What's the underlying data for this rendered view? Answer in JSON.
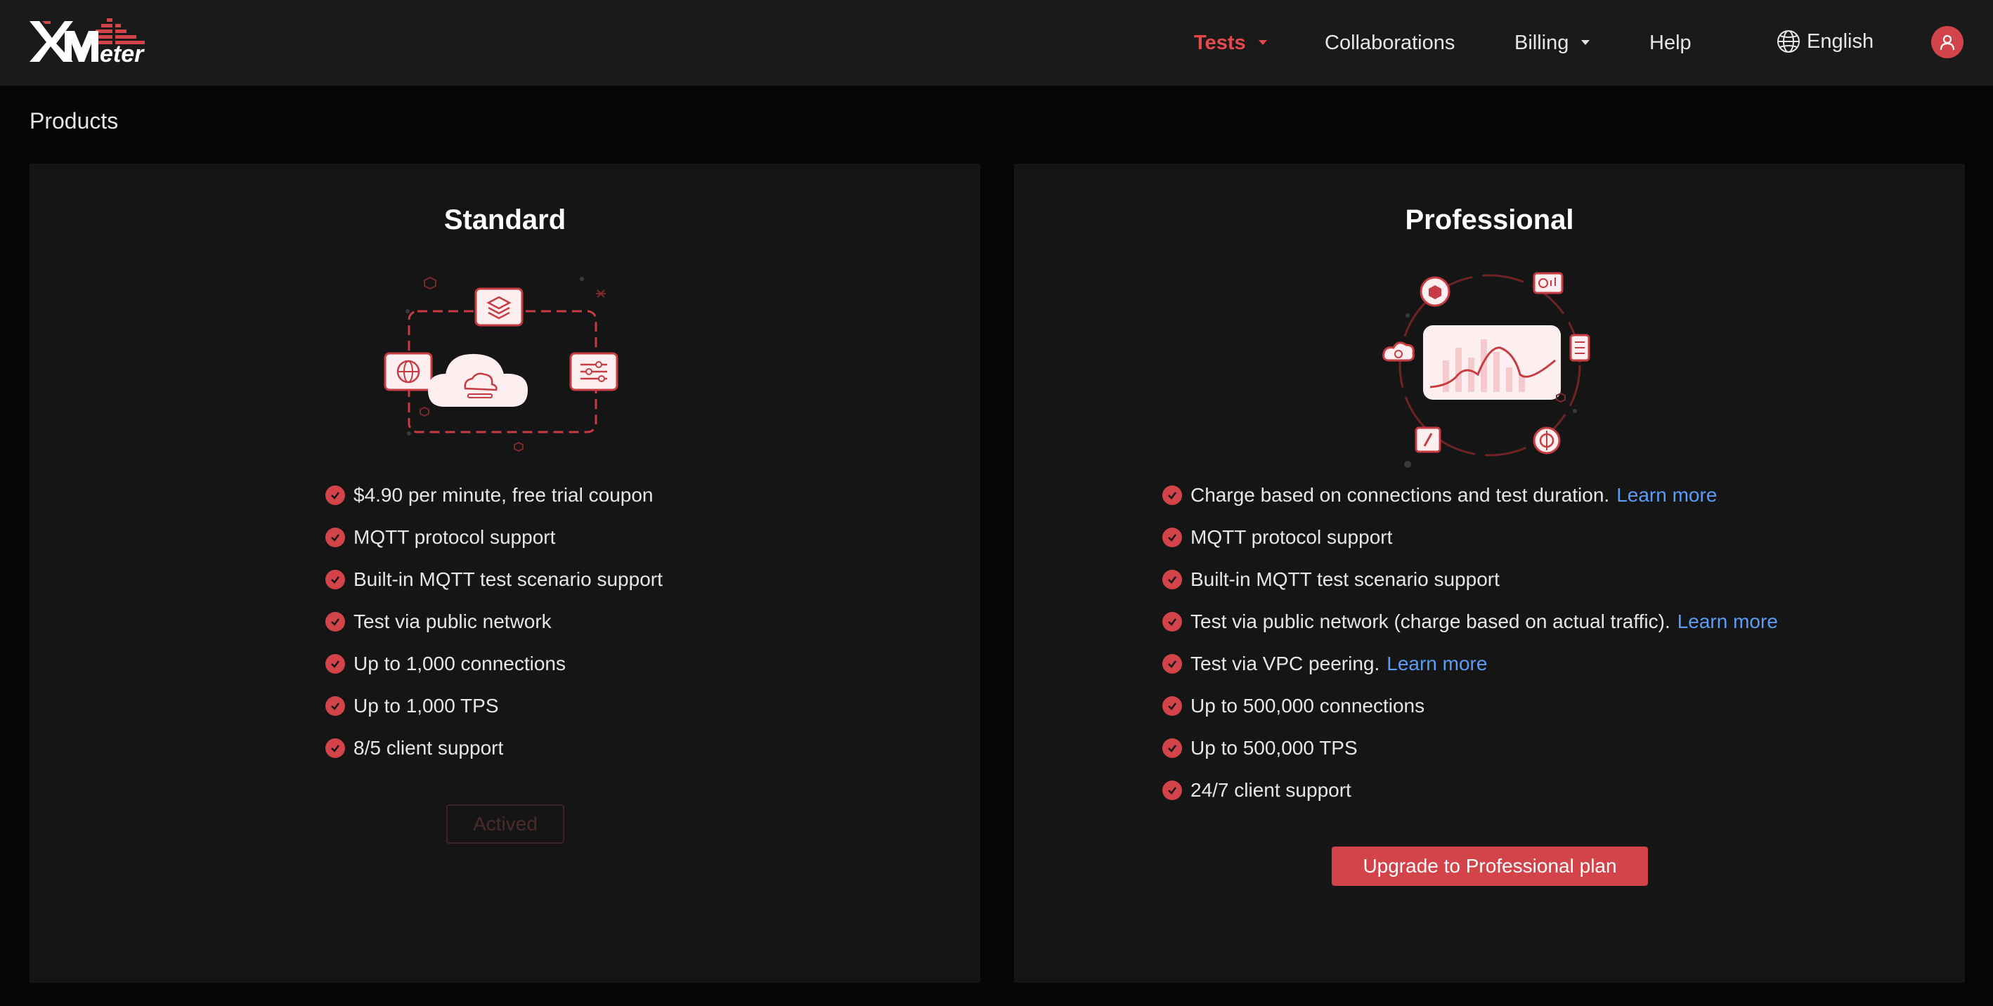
{
  "header": {
    "logo_text": "XMeter",
    "nav": {
      "tests": "Tests",
      "collaborations": "Collaborations",
      "billing": "Billing",
      "help": "Help"
    },
    "language": "English",
    "accent_color": "#e5484d"
  },
  "page": {
    "title": "Products"
  },
  "plans": {
    "standard": {
      "title": "Standard",
      "features": [
        {
          "text": "$4.90 per minute, free trial coupon"
        },
        {
          "text": "MQTT protocol support"
        },
        {
          "text": "Built-in MQTT test scenario support"
        },
        {
          "text": "Test via public network"
        },
        {
          "text": "Up to 1,000 connections"
        },
        {
          "text": "Up to 1,000 TPS"
        },
        {
          "text": "8/5 client support"
        }
      ],
      "button_label": "Actived",
      "button_state": "disabled"
    },
    "professional": {
      "title": "Professional",
      "features": [
        {
          "text": "Charge based on connections and test duration.",
          "link": "Learn more"
        },
        {
          "text": "MQTT protocol support"
        },
        {
          "text": "Built-in MQTT test scenario support"
        },
        {
          "text": "Test via public network (charge based on actual traffic).",
          "link": "Learn more"
        },
        {
          "text": "Test via VPC peering.",
          "link": "Learn more"
        },
        {
          "text": "Up to 500,000 connections"
        },
        {
          "text": "Up to 500,000 TPS"
        },
        {
          "text": "24/7 client support"
        }
      ],
      "button_label": "Upgrade to Professional plan"
    }
  },
  "icons": {
    "check": "check-circle-icon",
    "language": "globe-icon",
    "user": "user-icon",
    "dropdown": "caret-down-icon"
  }
}
